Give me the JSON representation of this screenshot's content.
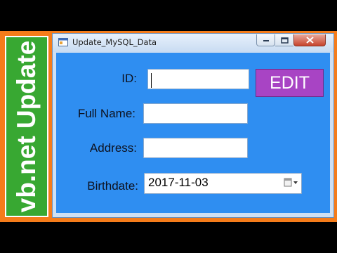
{
  "banner": {
    "text": "vb.net Update"
  },
  "window": {
    "title": "Update_MySQL_Data",
    "controls": {
      "minimize": "minimize",
      "maximize": "maximize",
      "close": "close"
    }
  },
  "form": {
    "id": {
      "label": "ID:",
      "value": ""
    },
    "full_name": {
      "label": "Full Name:",
      "value": ""
    },
    "address": {
      "label": "Address:",
      "value": ""
    },
    "birthdate": {
      "label": "Birthdate:",
      "value": "2017-11-03"
    },
    "edit_button": "EDIT"
  },
  "colors": {
    "frame": "#f57c1a",
    "banner": "#38a832",
    "client": "#2f8ef1",
    "edit_button": "#a844c4"
  },
  "icons": {
    "app": "window-app-icon",
    "calendar": "calendar-dropdown-icon"
  }
}
